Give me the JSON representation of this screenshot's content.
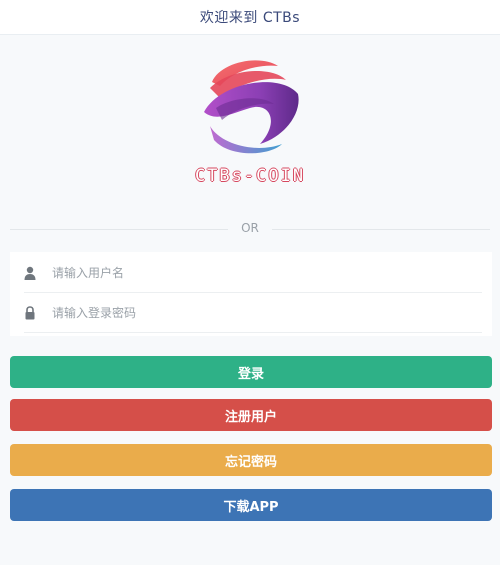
{
  "header": {
    "title": "欢迎来到 CTBs"
  },
  "logo": {
    "text": "CTBs-COIN"
  },
  "divider": {
    "text": "OR"
  },
  "form": {
    "username_placeholder": "请输入用户名",
    "password_placeholder": "请输入登录密码",
    "username_value": "",
    "password_value": ""
  },
  "buttons": {
    "login": "登录",
    "register": "注册用户",
    "forgot": "忘记密码",
    "download": "下载APP"
  },
  "colors": {
    "login": "#2eb187",
    "register": "#d54f49",
    "forgot": "#eaac4b",
    "download": "#3d74b5",
    "title": "#3b4a7a"
  },
  "icons": {
    "user": "user-icon",
    "password": "lock-icon"
  }
}
